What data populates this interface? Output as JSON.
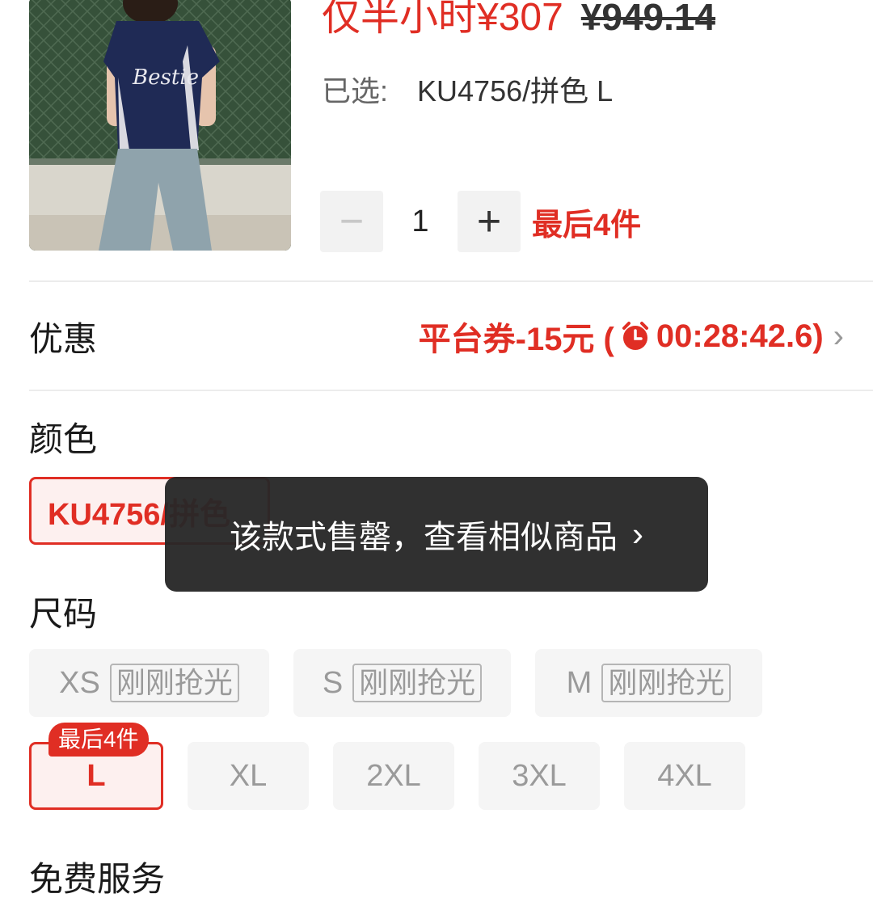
{
  "product": {
    "price_now": "仅半小时¥307",
    "price_old": "¥949.14",
    "selected_label": "已选:",
    "selected_value": "KU4756/拼色 L",
    "quantity": "1",
    "minus_symbol": "−",
    "plus_symbol": "+",
    "stock_warning": "最后4件"
  },
  "promo": {
    "label": "优惠",
    "coupon_text": "平台券-15元 (",
    "countdown": "00:28:42.6)",
    "chevron": "›"
  },
  "color_section": {
    "title": "颜色",
    "options": [
      "KU4756/拼色"
    ]
  },
  "size_section": {
    "title": "尺码",
    "sold_out_tag": "刚刚抢光",
    "sizes": [
      "XS",
      "S",
      "M",
      "L",
      "XL",
      "2XL",
      "3XL",
      "4XL"
    ],
    "selected_badge": "最后4件"
  },
  "service_section": {
    "title": "免费服务"
  },
  "toast": {
    "message": "该款式售罄，查看相似商品",
    "chevron": "›"
  },
  "colors": {
    "accent": "#e02e24",
    "toast_bg": "#282828",
    "chip_bg": "#f5f5f5"
  },
  "icons": {
    "clock": "alarm-clock-icon"
  }
}
